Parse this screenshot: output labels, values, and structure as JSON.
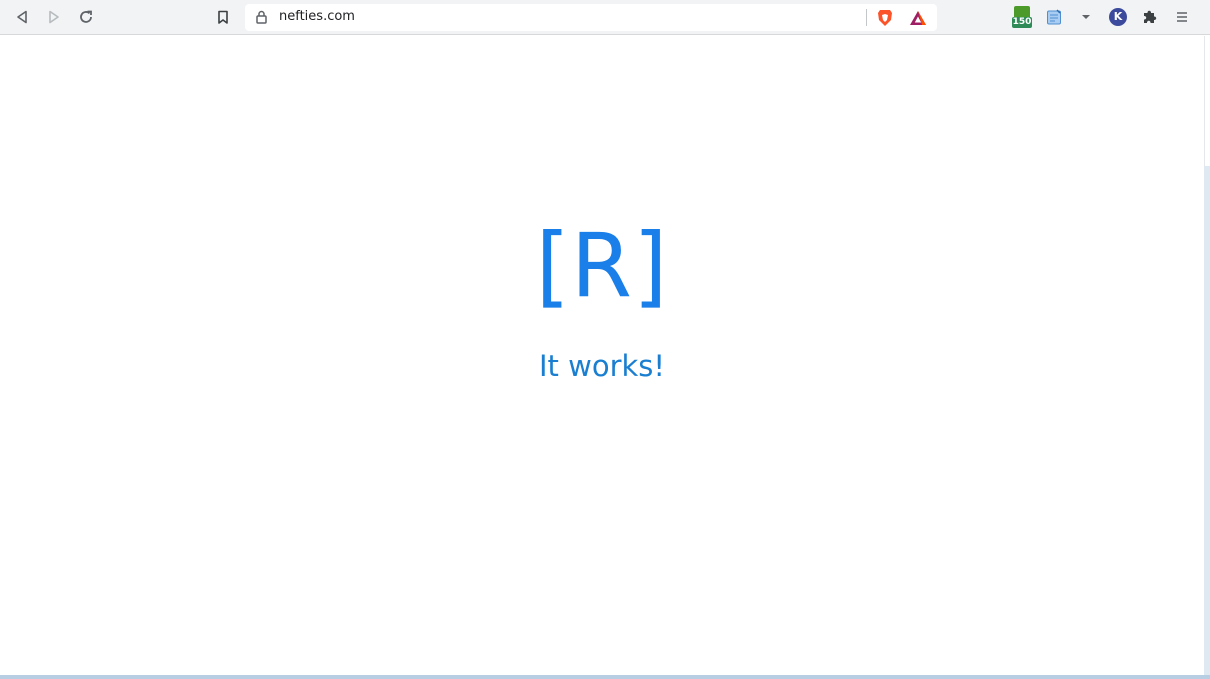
{
  "browser": {
    "url": "nefties.com",
    "extension_badge_count": "150",
    "profile_initial": "K"
  },
  "page": {
    "logo_text": "[R]",
    "message": "It works!"
  },
  "colors": {
    "logo": "#1a7fe8",
    "message": "#1a7fd0",
    "toolbar_bg": "#f1f3f4",
    "brave_orange": "#fb542b"
  },
  "icons": {
    "back": "back-icon",
    "forward": "forward-icon",
    "reload": "reload-icon",
    "bookmark": "bookmark-icon",
    "lock": "lock-icon",
    "brave_shields": "brave-shields-icon",
    "bat_rewards": "bat-rewards-icon",
    "extension_badge": "extension-badge-icon",
    "notes": "notes-extension-icon",
    "dropdown": "chevron-down-icon",
    "profile": "profile-avatar",
    "extensions": "puzzle-icon",
    "menu": "menu-icon"
  }
}
